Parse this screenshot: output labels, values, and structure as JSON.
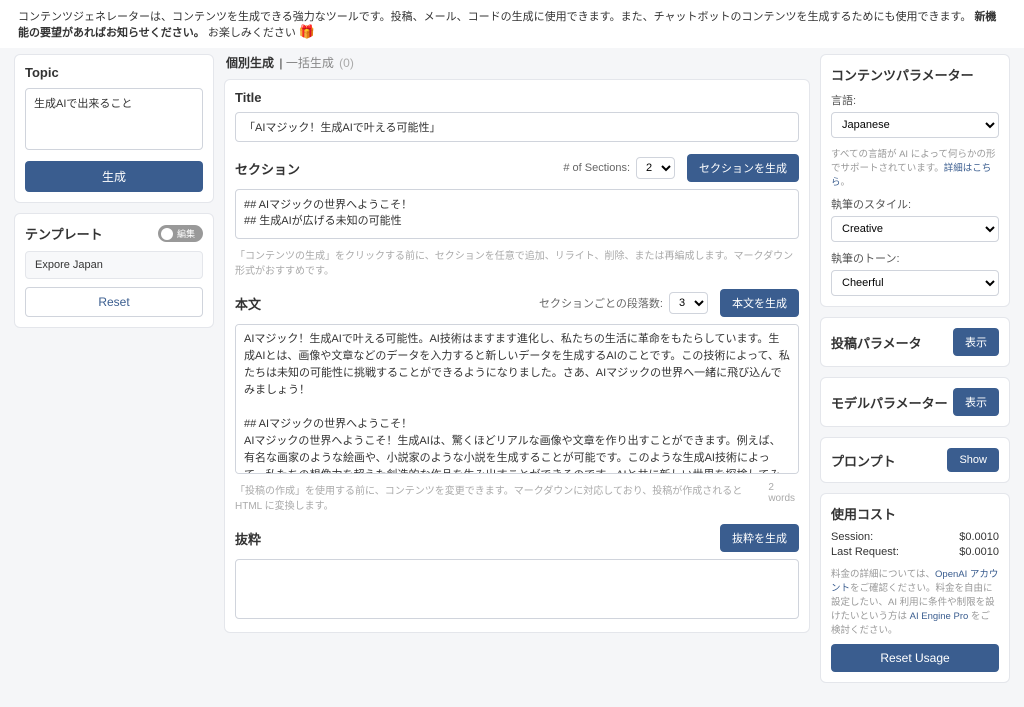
{
  "topbar": {
    "text": "コンテンツジェネレーターは、コンテンツを生成できる強力なツールです。投稿、メール、コードの生成に使用できます。また、チャットボットのコンテンツを生成するためにも使用できます。",
    "bold": "新機能の要望があればお知らせください。",
    "tail": "お楽しみください"
  },
  "left": {
    "topic": {
      "heading": "Topic",
      "value": "生成AIで出来ること",
      "btn": "生成"
    },
    "tmpl": {
      "heading": "テンプレート",
      "edit": "編集",
      "item": "Expore Japan",
      "reset": "Reset"
    }
  },
  "tabs": {
    "t1": "個別生成",
    "t2": "一括生成",
    "count": "(0)"
  },
  "title": {
    "label": "Title",
    "value": "「AIマジック！生成AIで叶える可能性」"
  },
  "sections": {
    "label": "セクション",
    "numLabel": "# of Sections:",
    "num": "2",
    "btn": "セクションを生成",
    "value": "## AIマジックの世界へようこそ！\n## 生成AIが広げる未知の可能性",
    "hint": "「コンテンツの生成」をクリックする前に、セクションを任意で追加、リライト、削除、または再編成します。マークダウン形式がおすすめです。"
  },
  "body": {
    "label": "本文",
    "numLabel": "セクションごとの段落数:",
    "num": "3",
    "btn": "本文を生成",
    "value": "AIマジック！生成AIで叶える可能性。AI技術はますます進化し、私たちの生活に革命をもたらしています。生成AIとは、画像や文章などのデータを入力すると新しいデータを生成するAIのことです。この技術によって、私たちは未知の可能性に挑戦することができるようになりました。さあ、AIマジックの世界へ一緒に飛び込んでみましょう！\n\n## AIマジックの世界へようこそ！\nAIマジックの世界へようこそ！生成AIは、驚くほどリアルな画像や文章を作り出すことができます。例えば、有名な画家のような絵画や、小説家のような小説を生成することが可能です。このような生成AI技術によって、私たちの想像力を超えた創造的な作品を生み出すことができるのです。AIと共に新しい世界を探検してみませんか？\n\n生成AIが広げる未知の可能性\n生成AIは、広大な未知の可能性を探求する手段としても活用されています。例えば、医療分野では生成AIが新しい薬の開発や病気の診断に活用されています。また、環境問題や社会問題に対処するための解決策を生成することもできるのです。生成AIが持つ無限の可能性を活用して、より良い未来を築いていくことが",
    "hint": "「投稿の作成」を使用する前に、コンテンツを変更できます。マークダウンに対応しており、投稿が作成されると HTML に変換します。",
    "words": "2 words"
  },
  "excerpt": {
    "label": "抜粋",
    "btn": "抜粋を生成"
  },
  "right": {
    "params": {
      "heading": "コンテンツパラメーター",
      "langLabel": "言語:",
      "lang": "Japanese",
      "langNote1": "すべての言語が AI によって何らかの形でサポートされています。",
      "langNoteLink": "詳細はこちら",
      "styleLabel": "執筆のスタイル:",
      "style": "Creative",
      "toneLabel": "執筆のトーン:",
      "tone": "Cheerful"
    },
    "post": {
      "heading": "投稿パラメータ",
      "btn": "表示"
    },
    "model": {
      "heading": "モデルパラメーター",
      "btn": "表示"
    },
    "prompt": {
      "heading": "プロンプト",
      "btn": "Show"
    },
    "cost": {
      "heading": "使用コスト",
      "sessionLabel": "Session:",
      "session": "$0.0010",
      "lastLabel": "Last Request:",
      "last": "$0.0010",
      "note1": "料金の詳細については、",
      "link1": "OpenAI アカウント",
      "note2": "をご確認ください。料金を自由に設定したい、AI 利用に条件や制限を設けたいという方は ",
      "link2": "AI Engine Pro",
      "note3": " をご検討ください。",
      "reset": "Reset Usage"
    }
  }
}
